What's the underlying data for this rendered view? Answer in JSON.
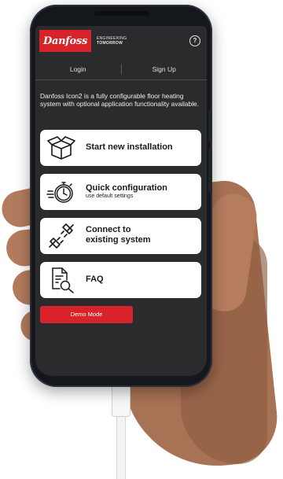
{
  "brand": {
    "logo_text": "Danfoss",
    "tagline_line1": "ENGINEERING",
    "tagline_line2": "TOMORROW",
    "accent_color": "#d8232a"
  },
  "header": {
    "help_icon_glyph": "?"
  },
  "tabs": [
    {
      "label": "Login"
    },
    {
      "label": "Sign Up"
    }
  ],
  "intro_text": "Danfoss Icon2 is a fully configurable floor heating system with optional application functionality available.",
  "cards": [
    {
      "title": "Start new installation",
      "icon": "box-icon"
    },
    {
      "title": "Quick configuration",
      "subtitle": "use default settings",
      "icon": "stopwatch-icon"
    },
    {
      "title_line1": "Connect to",
      "title_line2": "existing system",
      "icon": "plug-icon"
    },
    {
      "title": "FAQ",
      "icon": "document-search-icon"
    }
  ],
  "demo_button": {
    "label": "Demo Mode"
  }
}
